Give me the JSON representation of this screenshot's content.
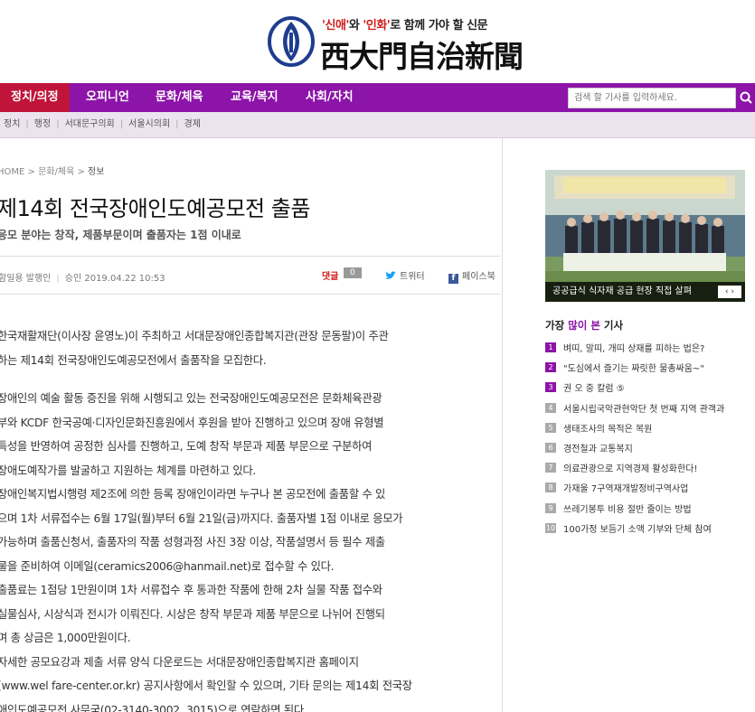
{
  "header": {
    "slogan_pre": "'신애'",
    "slogan_mid1": "와 ",
    "slogan_hl2": "'인화'",
    "slogan_post": "로 함께 가야 할 신문",
    "logo_name": "西大門自治新聞"
  },
  "nav": {
    "items": [
      "정치/의정",
      "오피니언",
      "문화/체육",
      "교육/복지",
      "사회/자치"
    ],
    "active_index": 0,
    "search_placeholder": "검색 할 기사를 입력하세요."
  },
  "subnav": {
    "items": [
      "정치",
      "행정",
      "서대문구의회",
      "서울시의회",
      "경제"
    ]
  },
  "breadcrumb": {
    "home": "HOME",
    "section": "문화/체육",
    "current": "정보"
  },
  "article": {
    "title": "제14회 전국장애인도예공모전 출품",
    "subtitle": "응모 분야는 창작, 제품부문이며 출품자는 1점 이내로",
    "author": "함일용 발행인",
    "date": "승인 2019.04.22 10:53",
    "comment_label": "댓글",
    "comment_count": "0",
    "twitter_label": "트위터",
    "facebook_label": "페이스북",
    "lines_p1": [
      "한국재활재단(이사장 윤영노)이 주최하고 서대문장애인종합복지관(관장 문동팔)이 주관",
      "하는 제14회 전국장애인도예공모전에서 출품작을 모집한다."
    ],
    "lines_p2": [
      "장애인의 예술 활동 증진을 위해 시행되고 있는 전국장애인도예공모전은 문화체육관광",
      "부와 KCDF 한국공예·디자인문화진흥원에서 후원을 받아 진행하고 있으며 장애 유형별",
      "특성을 반영하여 공정한 심사를 진행하고, 도예 창작 부문과 제품 부문으로 구분하여",
      "장애도예작가를 발굴하고 지원하는 체계를 마련하고 있다.",
      "장애인복지법시행령 제2조에 의한 등록 장애인이라면 누구나 본 공모전에 출품할 수 있",
      "으며 1차 서류접수는 6월 17일(월)부터 6월 21일(금)까지다. 출품자별 1점 이내로 응모가",
      "가능하며 출품신청서, 출품자의 작품 성형과정 사진 3장 이상, 작품설명서 등 필수 제출",
      "물을 준비하여 이메일(ceramics2006@hanmail.net)로 접수할 수 있다.",
      "출품료는 1점당 1만원이며 1차 서류접수 후 통과한 작품에 한해 2차 실물 작품 접수와",
      "실물심사, 시상식과 전시가 이뤄진다. 시상은 창작 부문과 제품 부문으로 나뉘어 진행되",
      "며 총 상금은 1,000만원이다.",
      "자세한 공모요강과 제출 서류 양식 다운로드는 서대문장애인종합복지관 홈페이지",
      "(www.wel fare-center.or.kr) 공지사항에서 확인할 수 있으며, 기타 문의는 제14회 전국장",
      "애인도예공모전 사무국(02-3140-3002, 3015)으로 연락하면 된다."
    ]
  },
  "sidebar": {
    "photo_caption": "공공급식 식자재 공급 현장 직접 살펴",
    "popular_title_pre": "가장 ",
    "popular_title_hl": "많이 본",
    "popular_title_post": " 기사",
    "popular": [
      "벼띠, 말띠, 개띠 상재를 피하는 법은?",
      "\"도심에서 즐기는 짜릿한 물총싸움~\"",
      "권 오 중 칼럼 ⑤",
      "서울시립국악관현악단 첫 번째 지역 관객과",
      "생태조사의 목적은 복원",
      "경전철과 교통복지",
      "의료관광으로 지역경제 활성화한다!",
      "가재울 7구역재개발정비구역사업",
      "쓰레기봉투 비용 절반 줄이는 방법",
      "100가정 보듬기 소액 기부와 단체 참여"
    ]
  }
}
